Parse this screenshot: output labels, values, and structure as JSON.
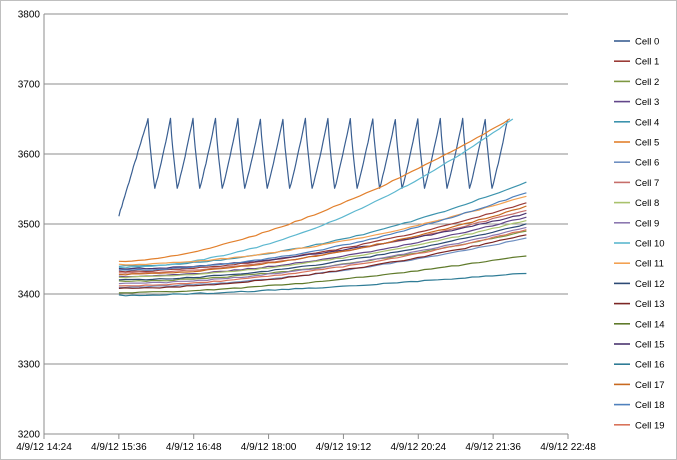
{
  "chart_data": {
    "type": "line",
    "title": "",
    "xlabel": "",
    "ylabel": "",
    "ylim": [
      3200,
      3800
    ],
    "y_ticks": [
      3200,
      3300,
      3400,
      3500,
      3600,
      3700,
      3800
    ],
    "x_tick_labels": [
      "4/9/12 14:24",
      "4/9/12 15:36",
      "4/9/12 16:48",
      "4/9/12 18:00",
      "4/9/12 19:12",
      "4/9/12 20:24",
      "4/9/12 21:36",
      "4/9/12 22:48"
    ],
    "grid": "horizontal",
    "legend_position": "right",
    "series": [
      {
        "name": "Cell 0",
        "color": "#3a5f92",
        "pattern": "sawtooth",
        "start_time": "15:36",
        "end_time": "21:50",
        "start_value": 3512,
        "min_value": 3551,
        "max_value": 3650,
        "cycles": 16
      },
      {
        "name": "Cell 1",
        "color": "#9b3b37",
        "start_time": "15:36",
        "end_time": "22:08",
        "start_value": 3432,
        "end_value": 3530,
        "curve": 1.8
      },
      {
        "name": "Cell 2",
        "color": "#7d9741",
        "start_time": "15:36",
        "end_time": "22:08",
        "start_value": 3418,
        "end_value": 3490,
        "curve": 1.8
      },
      {
        "name": "Cell 3",
        "color": "#62468a",
        "start_time": "15:36",
        "end_time": "22:08",
        "start_value": 3425,
        "end_value": 3510,
        "curve": 1.8
      },
      {
        "name": "Cell 4",
        "color": "#3c93ad",
        "start_time": "15:36",
        "end_time": "22:08",
        "start_value": 3440,
        "end_value": 3560,
        "curve": 1.9
      },
      {
        "name": "Cell 5",
        "color": "#e2802d",
        "start_time": "15:36",
        "end_time": "21:52",
        "start_value": 3446,
        "end_value": 3650,
        "curve": 1.6
      },
      {
        "name": "Cell 6",
        "color": "#6e8fc1",
        "start_time": "15:36",
        "end_time": "22:08",
        "start_value": 3410,
        "end_value": 3480,
        "curve": 1.8
      },
      {
        "name": "Cell 7",
        "color": "#c66e6a",
        "start_time": "15:36",
        "end_time": "22:08",
        "start_value": 3430,
        "end_value": 3520,
        "curve": 1.8
      },
      {
        "name": "Cell 8",
        "color": "#a9c26c",
        "start_time": "15:36",
        "end_time": "22:08",
        "start_value": 3424,
        "end_value": 3505,
        "curve": 1.8
      },
      {
        "name": "Cell 9",
        "color": "#8c78b0",
        "start_time": "15:36",
        "end_time": "22:08",
        "start_value": 3415,
        "end_value": 3495,
        "curve": 1.8
      },
      {
        "name": "Cell 10",
        "color": "#5cb7cf",
        "start_time": "15:36",
        "end_time": "21:55",
        "start_value": 3438,
        "end_value": 3650,
        "curve": 1.9
      },
      {
        "name": "Cell 11",
        "color": "#f3a152",
        "start_time": "15:36",
        "end_time": "22:08",
        "start_value": 3442,
        "end_value": 3540,
        "curve": 1.8
      },
      {
        "name": "Cell 12",
        "color": "#2c4a74",
        "start_time": "15:36",
        "end_time": "22:08",
        "start_value": 3420,
        "end_value": 3500,
        "curve": 1.8
      },
      {
        "name": "Cell 13",
        "color": "#7c2624",
        "start_time": "15:36",
        "end_time": "22:08",
        "start_value": 3408,
        "end_value": 3485,
        "curve": 1.8
      },
      {
        "name": "Cell 14",
        "color": "#5f7a2a",
        "start_time": "15:36",
        "end_time": "22:08",
        "start_value": 3402,
        "end_value": 3455,
        "curve": 1.7
      },
      {
        "name": "Cell 15",
        "color": "#4b3470",
        "start_time": "15:36",
        "end_time": "22:08",
        "start_value": 3436,
        "end_value": 3515,
        "curve": 1.8
      },
      {
        "name": "Cell 16",
        "color": "#2f7c96",
        "start_time": "15:36",
        "end_time": "22:08",
        "start_value": 3398,
        "end_value": 3430,
        "curve": 1.5
      },
      {
        "name": "Cell 17",
        "color": "#c8691f",
        "start_time": "15:36",
        "end_time": "22:08",
        "start_value": 3428,
        "end_value": 3525,
        "curve": 1.8
      },
      {
        "name": "Cell 18",
        "color": "#4f81bd",
        "start_time": "15:36",
        "end_time": "22:08",
        "start_value": 3434,
        "end_value": 3545,
        "curve": 1.9
      },
      {
        "name": "Cell 19",
        "color": "#d9735a",
        "start_time": "15:36",
        "end_time": "22:08",
        "start_value": 3412,
        "end_value": 3492,
        "curve": 1.8
      }
    ]
  }
}
